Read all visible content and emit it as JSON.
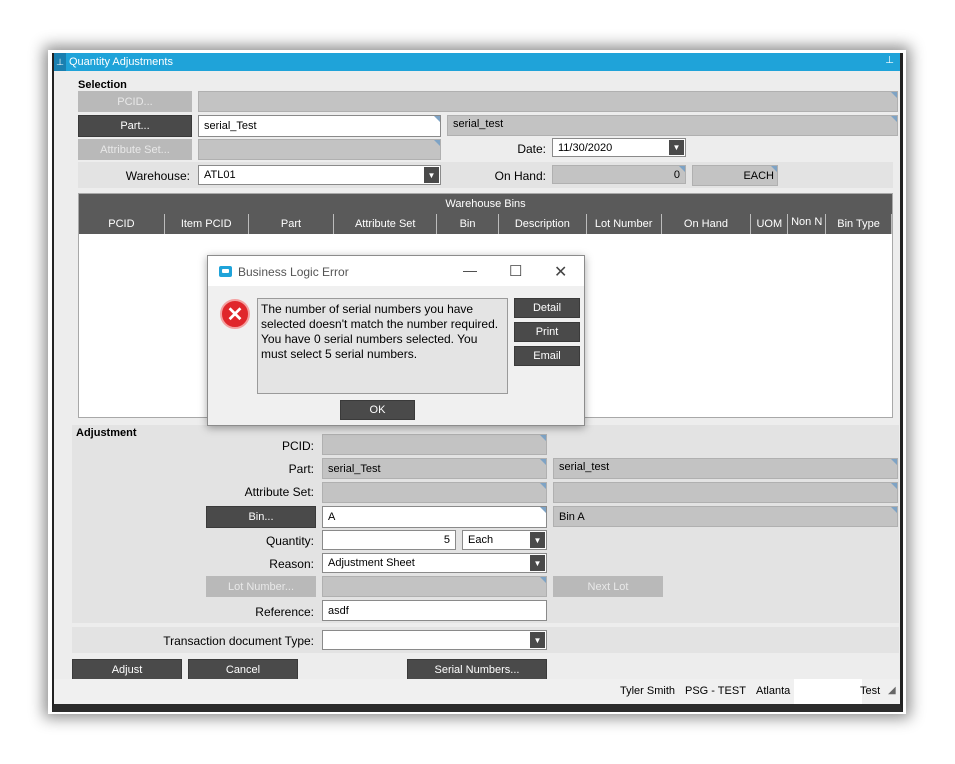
{
  "window": {
    "title": "Quantity Adjustments"
  },
  "selection": {
    "section_label": "Selection",
    "pcid_button": "PCID...",
    "part_button": "Part...",
    "part_value": "serial_Test",
    "part_description": "serial_test",
    "attribute_set_button": "Attribute Set...",
    "date_label": "Date:",
    "date_value": "11/30/2020",
    "warehouse_label": "Warehouse:",
    "warehouse_value": "ATL01",
    "on_hand_label": "On Hand:",
    "on_hand_value": "0",
    "uom_value": "EACH"
  },
  "warehouse_bins": {
    "title": "Warehouse Bins",
    "columns": [
      "PCID",
      "Item PCID",
      "Part",
      "Attribute Set",
      "Bin",
      "Description",
      "Lot Number",
      "On Hand",
      "UOM",
      "Non N",
      "Bin Type"
    ]
  },
  "adjustment": {
    "section_label": "Adjustment",
    "pcid_label": "PCID:",
    "part_label": "Part:",
    "part_value": "serial_Test",
    "part_description": "serial_test",
    "attribute_set_label": "Attribute Set:",
    "bin_button": "Bin...",
    "bin_value": "A",
    "bin_description": "Bin A",
    "quantity_label": "Quantity:",
    "quantity_value": "5",
    "quantity_uom": "Each",
    "reason_label": "Reason:",
    "reason_value": "Adjustment Sheet",
    "lot_number_button": "Lot Number...",
    "next_lot_button": "Next Lot",
    "reference_label": "Reference:",
    "reference_value": "asdf",
    "transaction_doc_type_label": "Transaction document Type:"
  },
  "footer_buttons": {
    "adjust": "Adjust",
    "cancel": "Cancel",
    "serial_numbers": "Serial Numbers..."
  },
  "status_bar": {
    "user": "Tyler Smith",
    "company": "PSG - TEST",
    "location": "Atlanta",
    "env": "Test"
  },
  "dialog": {
    "title": "Business Logic Error",
    "message": "The number of serial numbers you have selected doesn't match the number required. You have 0 serial numbers selected. You must select 5 serial numbers.",
    "detail_button": "Detail",
    "print_button": "Print",
    "email_button": "Email",
    "ok_button": "OK"
  }
}
